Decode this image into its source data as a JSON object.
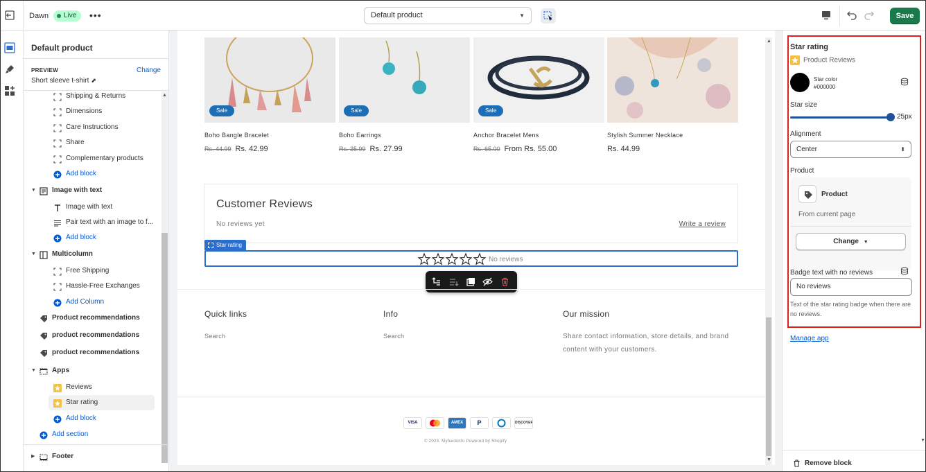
{
  "topbar": {
    "theme_name": "Dawn",
    "live_badge": "Live",
    "more": "•••",
    "template_select": "Default product",
    "save_label": "Save"
  },
  "sidebar": {
    "title": "Default product",
    "preview_label": "PREVIEW",
    "preview_change": "Change",
    "preview_value": "Short sleeve t-shirt",
    "items": [
      {
        "label": "Shipping & Returns",
        "icon": "block-icon"
      },
      {
        "label": "Dimensions",
        "icon": "block-icon"
      },
      {
        "label": "Care Instructions",
        "icon": "block-icon"
      },
      {
        "label": "Share",
        "icon": "block-icon"
      },
      {
        "label": "Complementary products",
        "icon": "block-icon"
      },
      {
        "label": "Add block",
        "icon": "plus-circle-icon"
      },
      {
        "label": "Image with text",
        "icon": "image-with-text-icon"
      },
      {
        "label": "Image with text",
        "icon": "text-t-icon"
      },
      {
        "label": "Pair text with an image to f...",
        "icon": "paragraph-icon"
      },
      {
        "label": "Add block",
        "icon": "plus-circle-icon"
      },
      {
        "label": "Multicolumn",
        "icon": "columns-icon"
      },
      {
        "label": "Free Shipping",
        "icon": "block-icon"
      },
      {
        "label": "Hassle-Free Exchanges",
        "icon": "block-icon"
      },
      {
        "label": "Add Column",
        "icon": "plus-circle-icon"
      },
      {
        "label": "Product recommendations",
        "icon": "tag-icon"
      },
      {
        "label": "product recommendations",
        "icon": "tag-icon"
      },
      {
        "label": "product recommendations",
        "icon": "tag-icon"
      },
      {
        "label": "Apps",
        "icon": "apps-section-icon"
      },
      {
        "label": "Reviews",
        "icon": "app-star-icon"
      },
      {
        "label": "Star rating",
        "icon": "app-star-icon"
      },
      {
        "label": "Add block",
        "icon": "plus-circle-icon"
      },
      {
        "label": "Add section",
        "icon": "plus-circle-icon"
      },
      {
        "label": "Footer",
        "icon": "footer-icon"
      }
    ]
  },
  "products": [
    {
      "name": "Boho Bangle Bracelet",
      "old_price": "Rs. 44.99",
      "price": "Rs. 42.99",
      "badge": "Sale"
    },
    {
      "name": "Boho Earrings",
      "old_price": "Rs. 35.99",
      "price": "Rs. 27.99",
      "badge": "Sale"
    },
    {
      "name": "Anchor Bracelet Mens",
      "old_price": "Rs. 65.00",
      "price": "From Rs. 55.00",
      "badge": "Sale"
    },
    {
      "name": "Stylish Summer Necklace",
      "old_price": "",
      "price": "Rs. 44.99",
      "badge": ""
    }
  ],
  "reviews": {
    "title": "Customer Reviews",
    "no_reviews_yet": "No reviews yet",
    "write_review": "Write a review",
    "star_tag": "Star rating",
    "badge_text": "No reviews"
  },
  "footer": {
    "quick_links_title": "Quick links",
    "quick_links_item": "Search",
    "info_title": "Info",
    "info_item": "Search",
    "mission_title": "Our mission",
    "mission_text": "Share contact information, store details, and brand content with your customers.",
    "payments": [
      "VISA",
      "MC",
      "AMEX",
      "PayPal",
      "DC",
      "DISCOVER"
    ],
    "copyright": "© 2023, Myhackinfo Powered by Shopify"
  },
  "settings": {
    "title": "Star rating",
    "app_name": "Product Reviews",
    "star_color_label": "Star color",
    "star_color_value": "#000000",
    "star_size_label": "Star size",
    "star_size_value": "25px",
    "alignment_label": "Alignment",
    "alignment_value": "Center",
    "product_label": "Product",
    "product_name": "Product",
    "product_sub": "From current page",
    "change_label": "Change",
    "badge_label": "Badge text with no reviews",
    "badge_value": "No reviews",
    "badge_help": "Text of the star rating badge when there are no reviews.",
    "manage_app": "Manage app",
    "remove_block": "Remove block"
  },
  "colors": {
    "accent_blue": "#2c6ecb",
    "save_green": "#1a7a4c",
    "highlight_red": "#e01e1e",
    "sale_badge": "#1c6fb7"
  }
}
